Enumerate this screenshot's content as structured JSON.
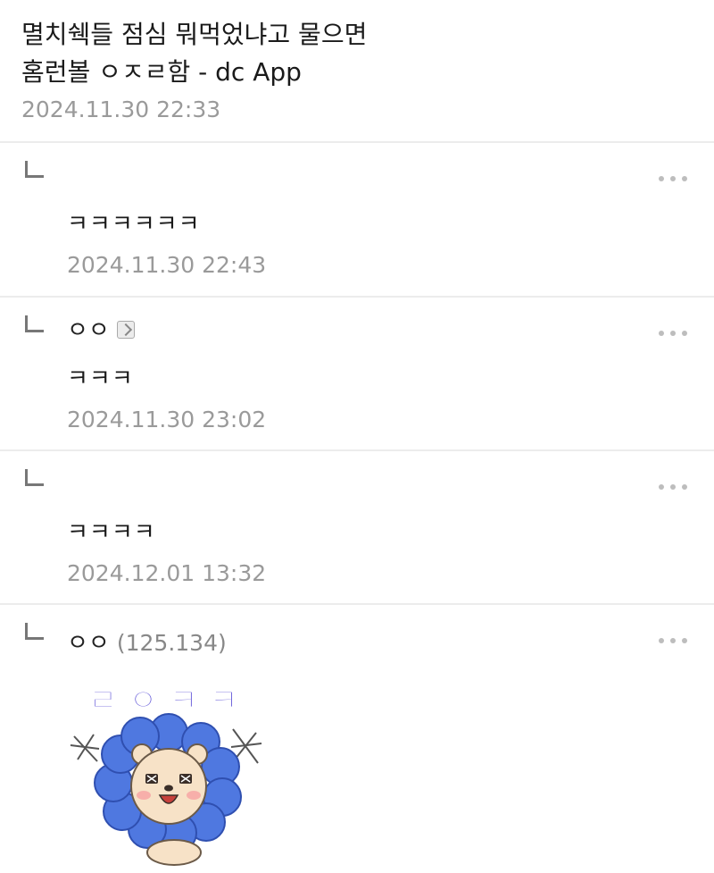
{
  "post": {
    "title_line1": "멸치쉑들 점심 뭐먹었냐고 물으면",
    "title_line2": "홈런볼 ㅇㅈㄹ함 - dc App",
    "date": "2024.11.30 22:33"
  },
  "comments": [
    {
      "nick": "",
      "ip": "",
      "text": "ㅋㅋㅋㅋㅋㅋ",
      "date": "2024.11.30 22:43"
    },
    {
      "nick": "ㅇㅇ",
      "ip": "",
      "text": "ㅋㅋㅋ",
      "date": "2024.11.30 23:02",
      "fixed_nick_icon": "fixed-nick-icon"
    },
    {
      "nick": "",
      "ip": "",
      "text": "ㅋㅋㅋㅋ",
      "date": "2024.12.01 13:32"
    },
    {
      "nick": "ㅇㅇ",
      "ip": "(125.134)",
      "sticker": {
        "text": "ㄹㅇㅋㅋ",
        "icon": "lion-flower-sticker"
      }
    }
  ],
  "icons": {
    "reply": "reply-arrow-icon",
    "more": "more-dots-icon"
  },
  "colors": {
    "sticker_text": "#5a4fd6",
    "petals": "#4f78e0",
    "lion": "#f7e2c7"
  }
}
